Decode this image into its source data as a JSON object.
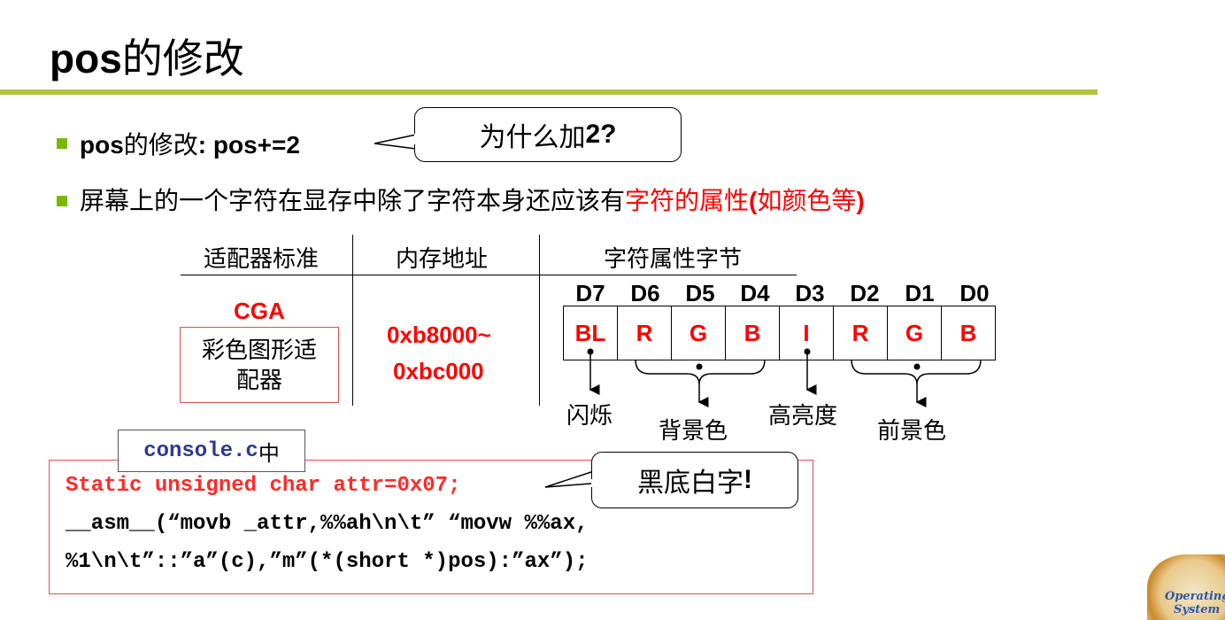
{
  "title": {
    "latin": "pos",
    "chinese": "的修改"
  },
  "bullets": {
    "b1_latin": "pos",
    "b1_zh": "的修改",
    "b1_rest": ": pos+=2",
    "b2_black": "屏幕上的一个字符在显存中除了字符本身还应该有",
    "b2_red1": "字符的属性",
    "b2_red2": "(",
    "b2_red3": "如颜色等",
    "b2_red4": ")"
  },
  "callout_why": {
    "zh": "为什么加",
    "num": "2?"
  },
  "table": {
    "headers": [
      "适配器标准",
      "内存地址",
      "字符属性字节"
    ],
    "adapter_name": "CGA",
    "adapter_desc_line1": "彩色图形适",
    "adapter_desc_line2": "配器",
    "address_line1": "0xb8000~",
    "address_line2": "0xbc000",
    "bit_labels": [
      "D7",
      "D6",
      "D5",
      "D4",
      "D3",
      "D2",
      "D1",
      "D0"
    ],
    "bit_values": [
      "BL",
      "R",
      "G",
      "B",
      "I",
      "R",
      "G",
      "B"
    ],
    "annotations": {
      "blink": "闪烁",
      "background": "背景色",
      "intensity": "高亮度",
      "foreground": "前景色"
    }
  },
  "code_tab": {
    "file": "console.c",
    "suffix": "中"
  },
  "code": {
    "line1": "Static unsigned char attr=0x07;",
    "line2": "__asm__(“movb _attr,%%ah\\n\\t” “movw %%ax,",
    "line3": "%1\\n\\t”::”a”(c),”m”(*(short *)pos):”ax”);"
  },
  "callout_black": {
    "zh": "黑底白字",
    "mark": "!"
  },
  "logo": {
    "line1": "Operating",
    "line2": "System"
  }
}
